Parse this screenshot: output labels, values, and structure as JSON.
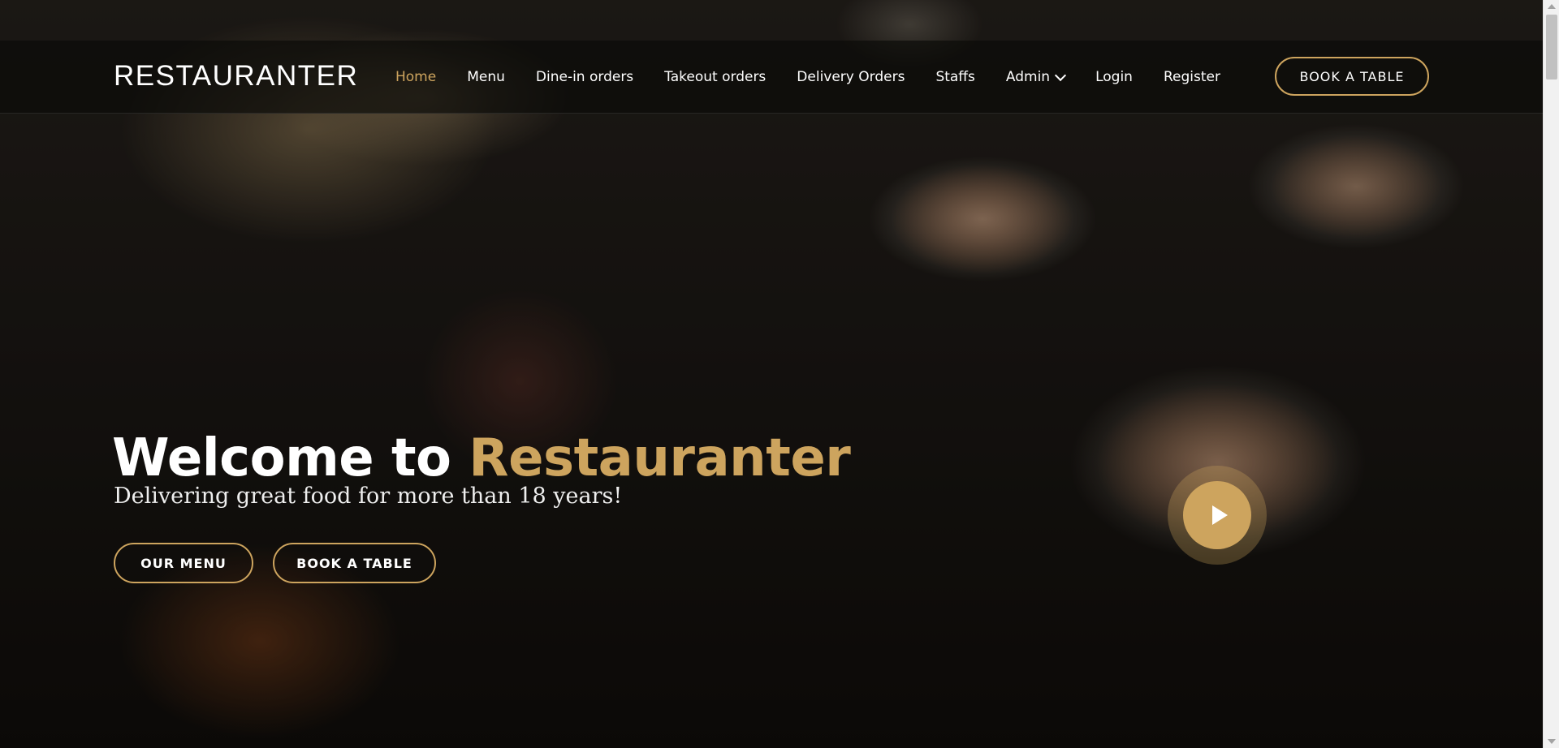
{
  "header": {
    "logo": "RESTAURANTER",
    "nav": [
      {
        "label": "Home",
        "active": true
      },
      {
        "label": "Menu"
      },
      {
        "label": "Dine-in orders"
      },
      {
        "label": "Takeout orders"
      },
      {
        "label": "Delivery Orders"
      },
      {
        "label": "Staffs"
      },
      {
        "label": "Admin",
        "has_dropdown": true
      },
      {
        "label": "Login"
      },
      {
        "label": "Register"
      }
    ],
    "book_button": "BOOK A TABLE"
  },
  "hero": {
    "title_prefix": "Welcome to ",
    "title_accent": "Restauranter",
    "subtitle": "Delivering great food for more than 18 years!",
    "menu_button": "OUR MENU",
    "book_button": "BOOK A TABLE",
    "play_icon": "play-icon"
  },
  "colors": {
    "accent": "#cda45e",
    "header_bg": "#0c0b09",
    "text": "#ffffff"
  }
}
